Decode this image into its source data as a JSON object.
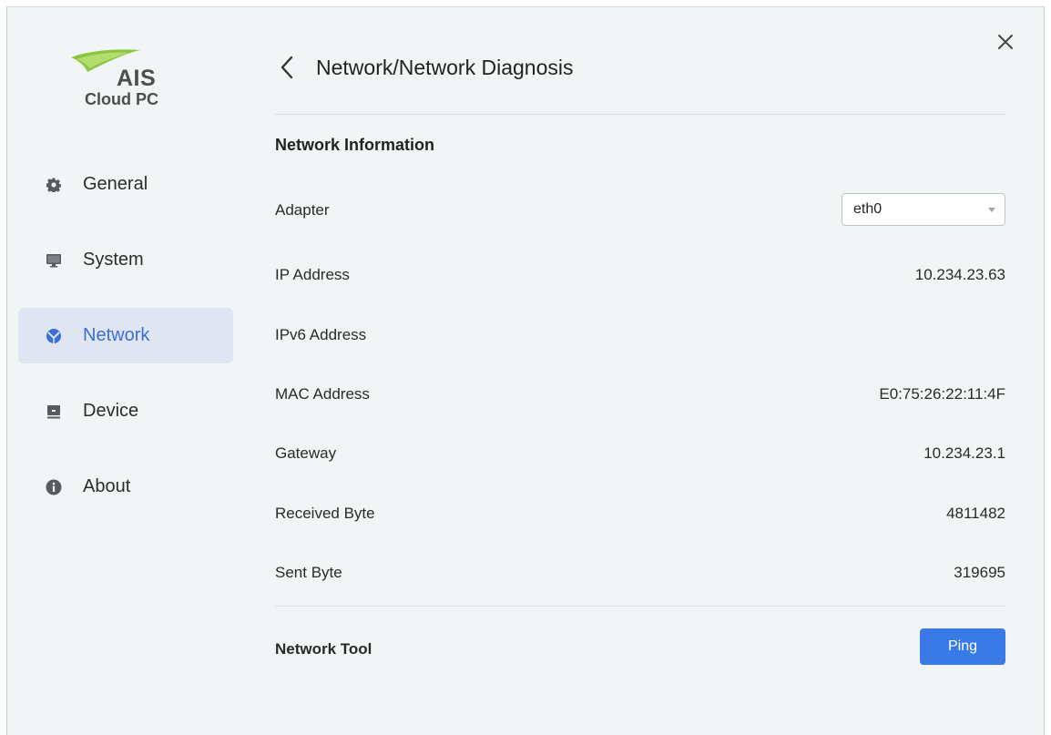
{
  "logo": {
    "brand": "AIS",
    "product": "Cloud PC"
  },
  "sidebar": {
    "items": [
      {
        "label": "General",
        "icon": "gear-icon",
        "active": false
      },
      {
        "label": "System",
        "icon": "monitor-icon",
        "active": false
      },
      {
        "label": "Network",
        "icon": "globe-icon",
        "active": true
      },
      {
        "label": "Device",
        "icon": "device-icon",
        "active": false
      },
      {
        "label": "About",
        "icon": "info-icon",
        "active": false
      }
    ]
  },
  "header": {
    "title": "Network/Network Diagnosis"
  },
  "network_info": {
    "section_title": "Network Information",
    "adapter_label": "Adapter",
    "adapter_value": "eth0",
    "rows": [
      {
        "label": "IP Address",
        "value": "10.234.23.63"
      },
      {
        "label": "IPv6 Address",
        "value": ""
      },
      {
        "label": "MAC Address",
        "value": "E0:75:26:22:11:4F"
      },
      {
        "label": "Gateway",
        "value": "10.234.23.1"
      },
      {
        "label": "Received Byte",
        "value": "4811482"
      },
      {
        "label": "Sent Byte",
        "value": "319695"
      }
    ]
  },
  "network_tool": {
    "section_title": "Network Tool",
    "ping_label": "Ping"
  },
  "colors": {
    "accent": "#3a7ae6",
    "active_nav_bg": "#dfe6f2",
    "active_nav_text": "#3a6fd8",
    "background": "#f2f5f5",
    "logo_green": "#8cc63f"
  }
}
